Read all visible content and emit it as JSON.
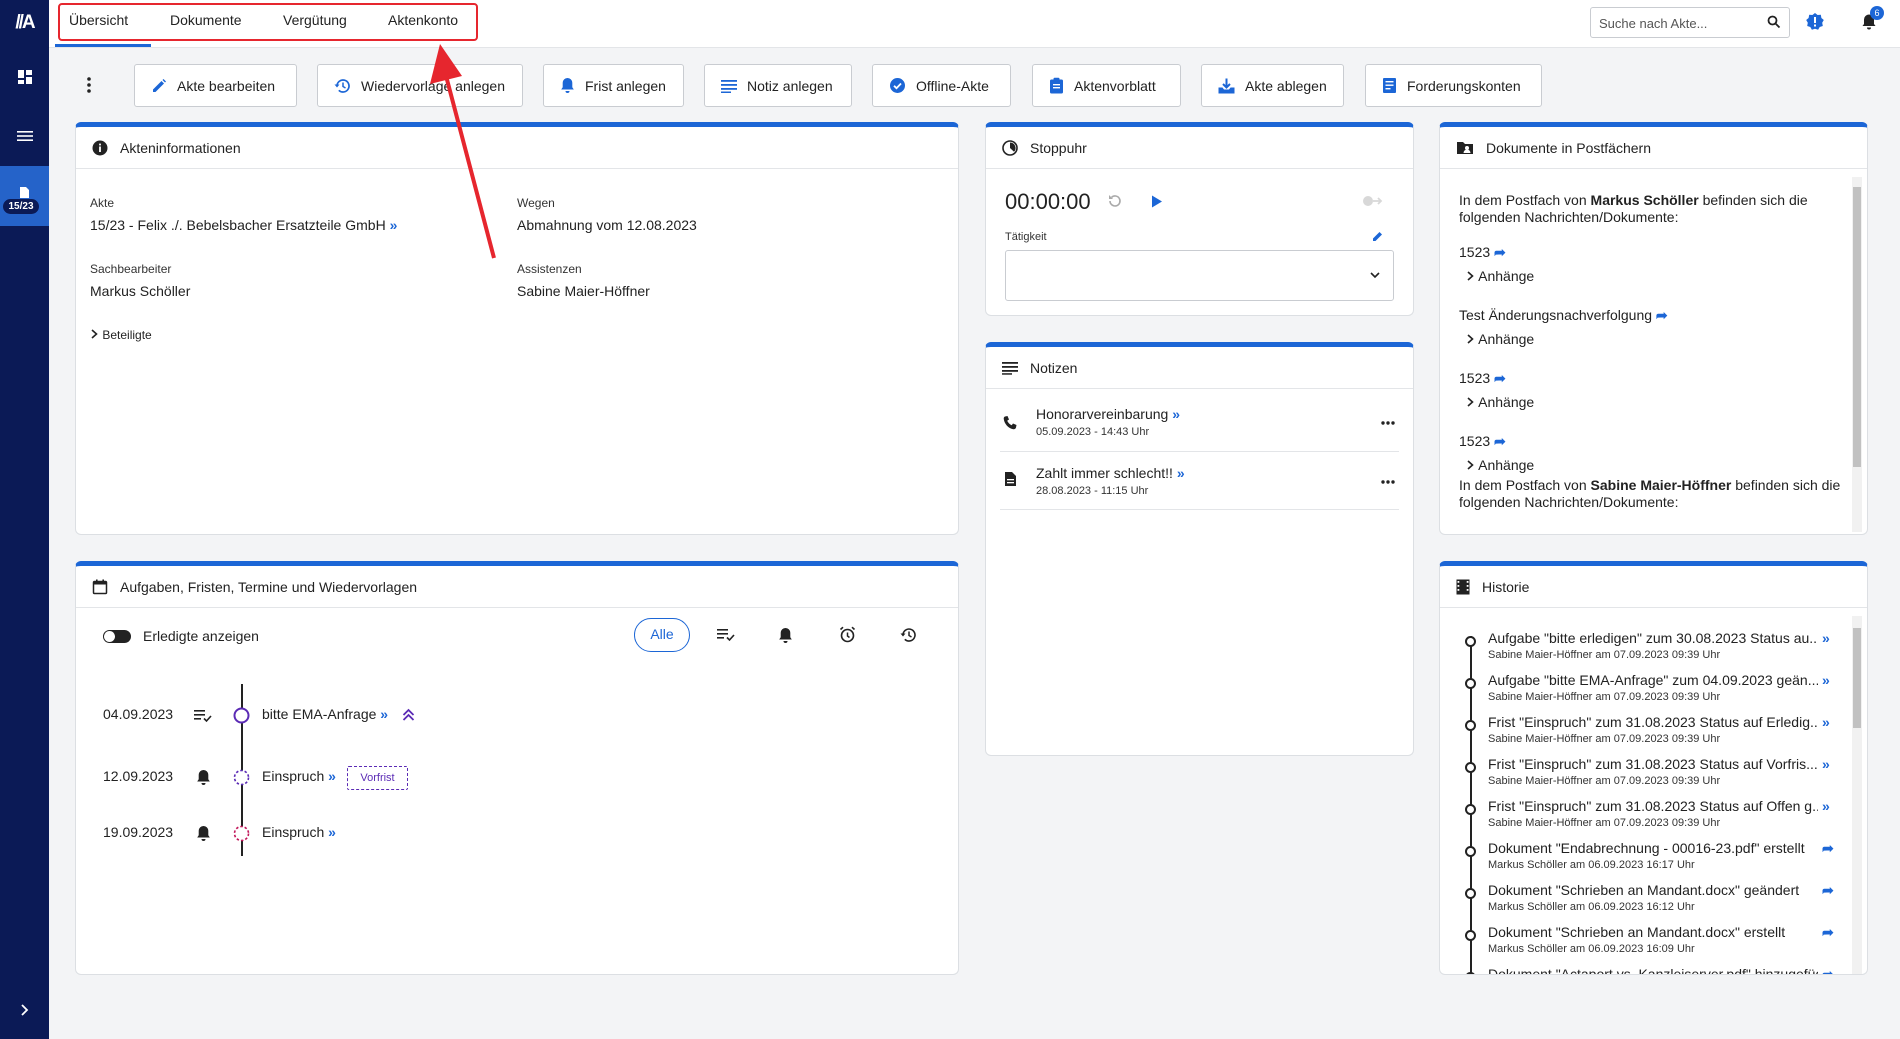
{
  "tabs": [
    "Übersicht",
    "Dokumente",
    "Vergütung",
    "Aktenkonto"
  ],
  "search": {
    "placeholder": "Suche nach Akte..."
  },
  "notifications_count": "6",
  "sidebar_badge": "15/23",
  "actions": [
    "Akte bearbeiten",
    "Wiedervorlage anlegen",
    "Frist anlegen",
    "Notiz anlegen",
    "Offline-Akte",
    "Aktenvorblatt",
    "Akte ablegen",
    "Forderungskonten"
  ],
  "akteninfo": {
    "title": "Akteninformationen",
    "akte_label": "Akte",
    "akte_value": "15/23 - Felix ./. Bebelsbacher Ersatzteile GmbH",
    "wegen_label": "Wegen",
    "wegen_value": "Abmahnung vom 12.08.2023",
    "sachbearbeiter_label": "Sachbearbeiter",
    "sachbearbeiter_value": "Markus Schöller",
    "assistenzen_label": "Assistenzen",
    "assistenzen_value": "Sabine Maier-Höffner",
    "beteiligte": "Beteiligte"
  },
  "stoppuhr": {
    "title": "Stoppuhr",
    "time": "00:00:00",
    "taetigkeit_label": "Tätigkeit"
  },
  "notizen": {
    "title": "Notizen",
    "items": [
      {
        "title": "Honorarvereinbarung",
        "date": "05.09.2023 - 14:43 Uhr"
      },
      {
        "title": "Zahlt immer schlecht!!",
        "date": "28.08.2023 - 11:15 Uhr"
      }
    ]
  },
  "dokumente": {
    "title": "Dokumente in Postfächern",
    "intro1_pre": "In dem Postfach von ",
    "intro1_name": "Markus Schöller",
    "intro1_post": " befinden sich die",
    "intro_line2": "folgenden Nachrichten/Dokumente:",
    "items": [
      "1523",
      "Test Änderungsnachverfolgung",
      "1523",
      "1523"
    ],
    "anhaenge": "Anhänge",
    "intro2_pre": "In dem Postfach von ",
    "intro2_name": "Sabine Maier-Höffner",
    "intro2_post": " befinden sich die"
  },
  "aufgaben": {
    "title": "Aufgaben, Fristen, Termine und Wiedervorlagen",
    "toggle_label": "Erledigte anzeigen",
    "filter_all": "Alle",
    "items": [
      {
        "date": "04.09.2023",
        "title": "bitte EMA-Anfrage"
      },
      {
        "date": "12.09.2023",
        "title": "Einspruch",
        "tag": "Vorfrist"
      },
      {
        "date": "19.09.2023",
        "title": "Einspruch"
      }
    ]
  },
  "historie": {
    "title": "Historie",
    "items": [
      {
        "title": "Aufgabe \"bitte erledigen\" zum 30.08.2023 Status au...",
        "meta": "Sabine Maier-Höffner am 07.09.2023 09:39 Uhr"
      },
      {
        "title": "Aufgabe \"bitte EMA-Anfrage\" zum 04.09.2023 geän...",
        "meta": "Sabine Maier-Höffner am 07.09.2023 09:39 Uhr"
      },
      {
        "title": "Frist \"Einspruch\" zum 31.08.2023 Status auf Erledig...",
        "meta": "Sabine Maier-Höffner am 07.09.2023 09:39 Uhr"
      },
      {
        "title": "Frist \"Einspruch\" zum 31.08.2023 Status auf Vorfris...",
        "meta": "Sabine Maier-Höffner am 07.09.2023 09:39 Uhr"
      },
      {
        "title": "Frist \"Einspruch\" zum 31.08.2023 Status auf Offen g...",
        "meta": "Sabine Maier-Höffner am 07.09.2023 09:39 Uhr"
      },
      {
        "title": "Dokument \"Endabrechnung - 00016-23.pdf\" erstellt",
        "meta": "Markus Schöller am 06.09.2023 16:17 Uhr"
      },
      {
        "title": "Dokument \"Schrieben an Mandant.docx\" geändert",
        "meta": "Markus Schöller am 06.09.2023 16:12 Uhr"
      },
      {
        "title": "Dokument \"Schrieben an Mandant.docx\" erstellt",
        "meta": "Markus Schöller am 06.09.2023 16:09 Uhr"
      },
      {
        "title": "Dokument \"Actaport vs. Kanzleiserver.pdf\" hinzugefügt",
        "meta": ""
      }
    ]
  },
  "colors": {
    "accent": "#1c66d6",
    "sidebar": "#0b1a56",
    "annotation": "#e6262e",
    "purple": "#5b2bb5",
    "red": "#c2185b"
  }
}
